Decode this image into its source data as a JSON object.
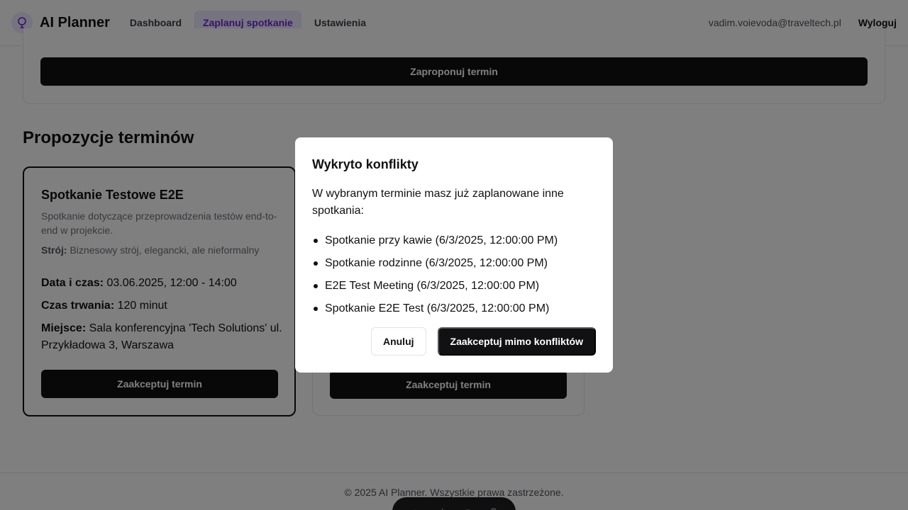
{
  "header": {
    "app_title": "AI Planner",
    "nav": [
      {
        "label": "Dashboard",
        "active": false
      },
      {
        "label": "Zaplanuj spotkanie",
        "active": true
      },
      {
        "label": "Ustawienia",
        "active": false
      }
    ],
    "user_email": "vadim.voievoda@traveltech.pl",
    "logout_label": "Wyloguj",
    "logo_icon": "bulb-icon"
  },
  "form": {
    "propose_button": "Zaproponuj termin"
  },
  "proposals": {
    "section_title": "Propozycje terminów",
    "cards": [
      {
        "title": "Spotkanie Testowe E2E",
        "description": "Spotkanie dotyczące przeprowadzenia testów end-to-end w projekcie.",
        "dress_label": "Strój:",
        "dress_value": "Biznesowy strój, elegancki, ale nieformalny",
        "datetime_label": "Data i czas:",
        "datetime_value": "03.06.2025, 12:00 - 14:00",
        "duration_label": "Czas trwania:",
        "duration_value": "120 minut",
        "place_label": "Miejsce:",
        "place_value": "Sala konferencyjna 'Tech Solutions' ul. Przykładowa 3, Warszawa",
        "accept_button": "Zaakceptuj termin"
      },
      {
        "accept_button": "Zaakceptuj termin"
      }
    ]
  },
  "footer": {
    "text": "© 2025 AI Planner. Wszystkie prawa zastrzeżone."
  },
  "modal": {
    "title": "Wykryto konflikty",
    "message": "W wybranym terminie masz już zaplanowane inne spotkania:",
    "conflicts": [
      "Spotkanie przy kawie (6/3/2025, 12:00:00 PM)",
      "Spotkanie rodzinne (6/3/2025, 12:00:00 PM)",
      "E2E Test Meeting (6/3/2025, 12:00:00 PM)",
      "Spotkanie E2E Test (6/3/2025, 12:00:00 PM)"
    ],
    "cancel_button": "Anuluj",
    "confirm_button": "Zaakceptuj mimo konfliktów"
  },
  "colors": {
    "accent": "#6d28d9",
    "accent_bg": "#ede9fe",
    "button_dark": "#111113",
    "overlay": "rgba(0,0,0,0.5)"
  }
}
